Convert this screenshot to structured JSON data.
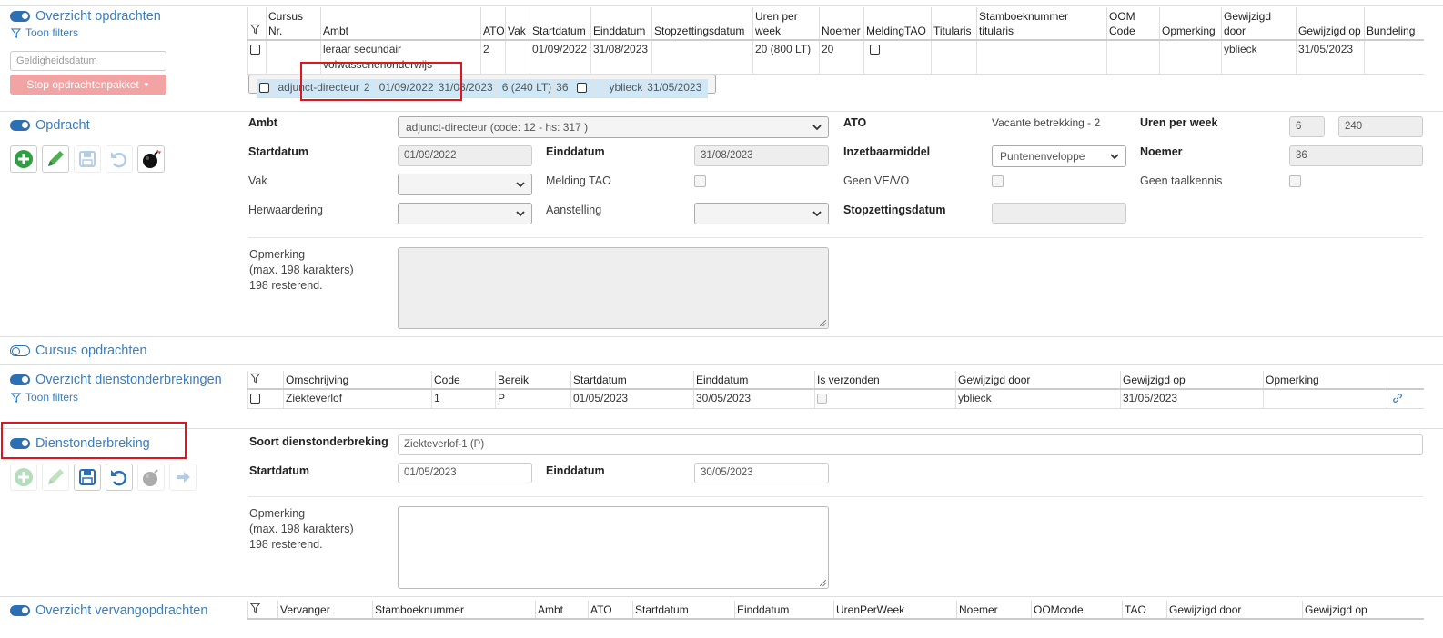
{
  "overzicht_opdrachten": {
    "title": "Overzicht opdrachten",
    "filters_label": "Toon filters",
    "date_placeholder": "Geldigheidsdatum",
    "stop_button": "Stop opdrachtenpakket",
    "columns": [
      "Cursus Nr.",
      "Ambt",
      "ATO",
      "Vak",
      "Startdatum",
      "Einddatum",
      "Stopzettingsdatum",
      "Uren per week",
      "Noemer",
      "MeldingTAO",
      "Titularis",
      "Stamboeknummer titularis",
      "OOM Code",
      "Opmerking",
      "Gewijzigd door",
      "Gewijzigd op",
      "Bundeling"
    ],
    "rows": [
      {
        "cursus": "",
        "ambt": "leraar secundair volwassenenonderwijs",
        "ato": "2",
        "vak": "",
        "start": "01/09/2022",
        "eind": "31/08/2023",
        "stop": "",
        "uren": "20 (800 LT)",
        "noemer": "20",
        "titularis": "",
        "stamboek": "",
        "oom": "",
        "opmerking": "",
        "door": "yblieck",
        "op": "31/05/2023",
        "bundeling": ""
      },
      {
        "cursus": "",
        "ambt": "adjunct-directeur",
        "ato": "2",
        "vak": "",
        "start": "01/09/2022",
        "eind": "31/08/2023",
        "stop": "",
        "uren": "6 (240 LT)",
        "noemer": "36",
        "titularis": "",
        "stamboek": "",
        "oom": "",
        "opmerking": "",
        "door": "yblieck",
        "op": "31/05/2023",
        "bundeling": ""
      }
    ]
  },
  "opdracht": {
    "title": "Opdracht",
    "ambt_label": "Ambt",
    "ambt_value": "adjunct-directeur (code: 12 - hs: 317 )",
    "ato_label": "ATO",
    "ato_value": "Vacante betrekking - 2",
    "uren_label": "Uren per week",
    "uren_value": "6",
    "uren_lt_value": "240",
    "startdatum_label": "Startdatum",
    "startdatum_value": "01/09/2022",
    "einddatum_label": "Einddatum",
    "einddatum_value": "31/08/2023",
    "inzetbaar_label": "Inzetbaarmiddel",
    "inzetbaar_value": "Puntenenveloppe",
    "noemer_label": "Noemer",
    "noemer_value": "36",
    "vak_label": "Vak",
    "melding_label": "Melding TAO",
    "geen_vevo_label": "Geen VE/VO",
    "geen_taal_label": "Geen taalkennis",
    "herwaardering_label": "Herwaardering",
    "aanstelling_label": "Aanstelling",
    "stopzetting_label": "Stopzettingsdatum",
    "opmerking_label": "Opmerking",
    "max_label": "(max. 198 karakters)",
    "resterend_label": "198 resterend."
  },
  "cursus_opdrachten": {
    "title": "Cursus opdrachten"
  },
  "overzicht_dienstonderbrekingen": {
    "title": "Overzicht dienstonderbrekingen",
    "filters_label": "Toon filters",
    "columns": [
      "Omschrijving",
      "Code",
      "Bereik",
      "Startdatum",
      "Einddatum",
      "Is verzonden",
      "Gewijzigd door",
      "Gewijzigd op",
      "Opmerking"
    ],
    "rows": [
      {
        "omschrijving": "Ziekteverlof",
        "code": "1",
        "bereik": "P",
        "start": "01/05/2023",
        "eind": "30/05/2023",
        "door": "yblieck",
        "op": "31/05/2023",
        "opmerking": ""
      }
    ]
  },
  "dienstonderbreking": {
    "title": "Dienstonderbreking",
    "soort_label": "Soort dienstonderbreking",
    "soort_value": "Ziekteverlof-1 (P)",
    "startdatum_label": "Startdatum",
    "startdatum_value": "01/05/2023",
    "einddatum_label": "Einddatum",
    "einddatum_value": "30/05/2023",
    "opmerking_label": "Opmerking",
    "max_label": "(max. 198 karakters)",
    "resterend_label": "198 resterend."
  },
  "overzicht_vervangopdrachten": {
    "title": "Overzicht vervangopdrachten",
    "columns": [
      "Vervanger",
      "Stamboeknummer",
      "Ambt",
      "ATO",
      "Startdatum",
      "Einddatum",
      "UrenPerWeek",
      "Noemer",
      "OOMcode",
      "TAO",
      "Gewijzigd door",
      "Gewijzigd op"
    ]
  },
  "colors": {
    "accent": "#3a7dbf",
    "selected_row": "#cfe8f7",
    "highlight_box": "#e0161e",
    "stop_button": "#f2a3a3"
  }
}
